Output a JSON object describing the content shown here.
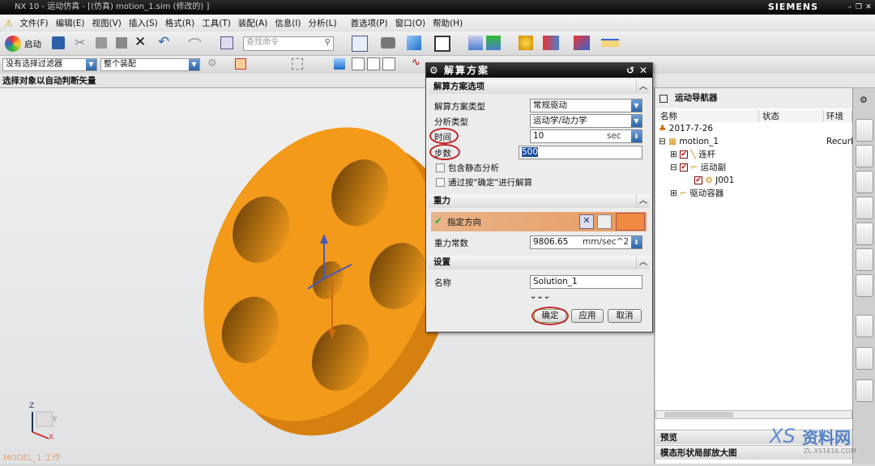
{
  "window": {
    "title": "NX 10 - 运动仿真 - [(仿真) motion_1.sim (修改的) ]",
    "brand": "SIEMENS"
  },
  "menu": [
    "文件(F)",
    "编辑(E)",
    "视图(V)",
    "插入(S)",
    "格式(R)",
    "工具(T)",
    "装配(A)",
    "信息(I)",
    "分析(L)",
    "首选项(P)",
    "窗口(O)",
    "帮助(H)"
  ],
  "toolbar": {
    "start_label": "启动",
    "search_placeholder": "查找命令"
  },
  "filter": {
    "selection_filter": "没有选择过滤器",
    "scope": "整个装配"
  },
  "prompt": "选择对象以自动判断矢量",
  "viewport": {
    "work_label": "MODEL_1 工作",
    "triad": {
      "z": "Z",
      "y": "Y",
      "x": "X"
    }
  },
  "dialog": {
    "title": "解算方案",
    "sections": {
      "options": {
        "title": "解算方案选项",
        "solution_type_label": "解算方案类型",
        "solution_type": "常规驱动",
        "analysis_type_label": "分析类型",
        "analysis_type": "运动学/动力学",
        "time_label": "时间",
        "time_value": "10",
        "time_unit": "sec",
        "steps_label": "步数",
        "steps_value": "500",
        "static_check": "包含静态分析",
        "static_checked": false,
        "ok_solve_check": "通过按\"确定\"进行解算",
        "ok_solve_checked": false
      },
      "gravity": {
        "title": "重力",
        "direction_label": "指定方向",
        "constant_label": "重力常数",
        "constant_value": "9806.65",
        "constant_unit": "mm/sec^2"
      },
      "settings": {
        "title": "设置",
        "name_label": "名称",
        "name_value": "Solution_1"
      }
    },
    "buttons": {
      "ok": "确定",
      "apply": "应用",
      "cancel": "取消"
    }
  },
  "navigator": {
    "title": "运动导航器",
    "columns": [
      "名称",
      "状态",
      "环境"
    ],
    "tree": [
      {
        "label": "2017-7-26",
        "env": ""
      },
      {
        "label": "motion_1",
        "env": "RecurD"
      },
      {
        "label": "连杆",
        "checked": true
      },
      {
        "label": "运动副",
        "checked": true
      },
      {
        "label": "J001",
        "checked": true
      },
      {
        "label": "驱动容器"
      }
    ],
    "preview": "预览",
    "mode_shape": "模态形状局部放大图"
  },
  "watermark": {
    "text": "资料网",
    "url": "ZL.XS1616.COM"
  },
  "colors": {
    "part": "#f39a1a",
    "highlight": "#c0282e",
    "accent": "#2d64a8"
  }
}
